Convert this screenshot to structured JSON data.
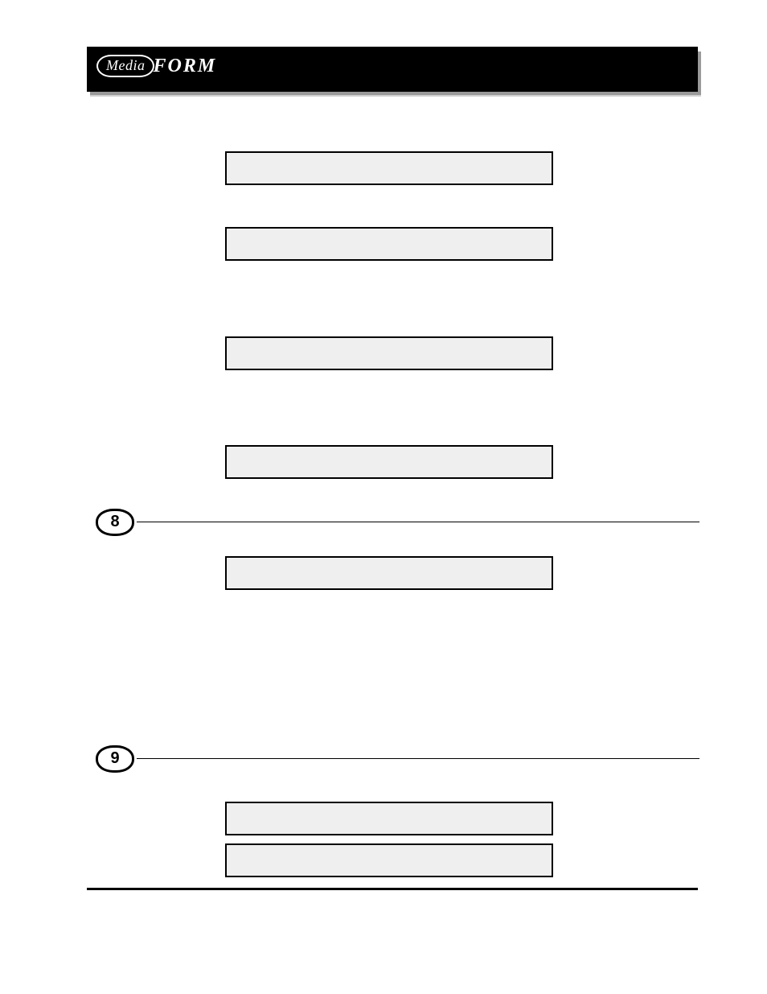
{
  "header": {
    "logo_part1": "Media",
    "logo_part2": "FORM"
  },
  "steps": [
    {
      "number": "8"
    },
    {
      "number": "9"
    }
  ],
  "lcd_boxes": [
    {
      "text": ""
    },
    {
      "text": ""
    },
    {
      "text": ""
    },
    {
      "text": ""
    },
    {
      "text": ""
    },
    {
      "text": ""
    },
    {
      "text": ""
    }
  ]
}
